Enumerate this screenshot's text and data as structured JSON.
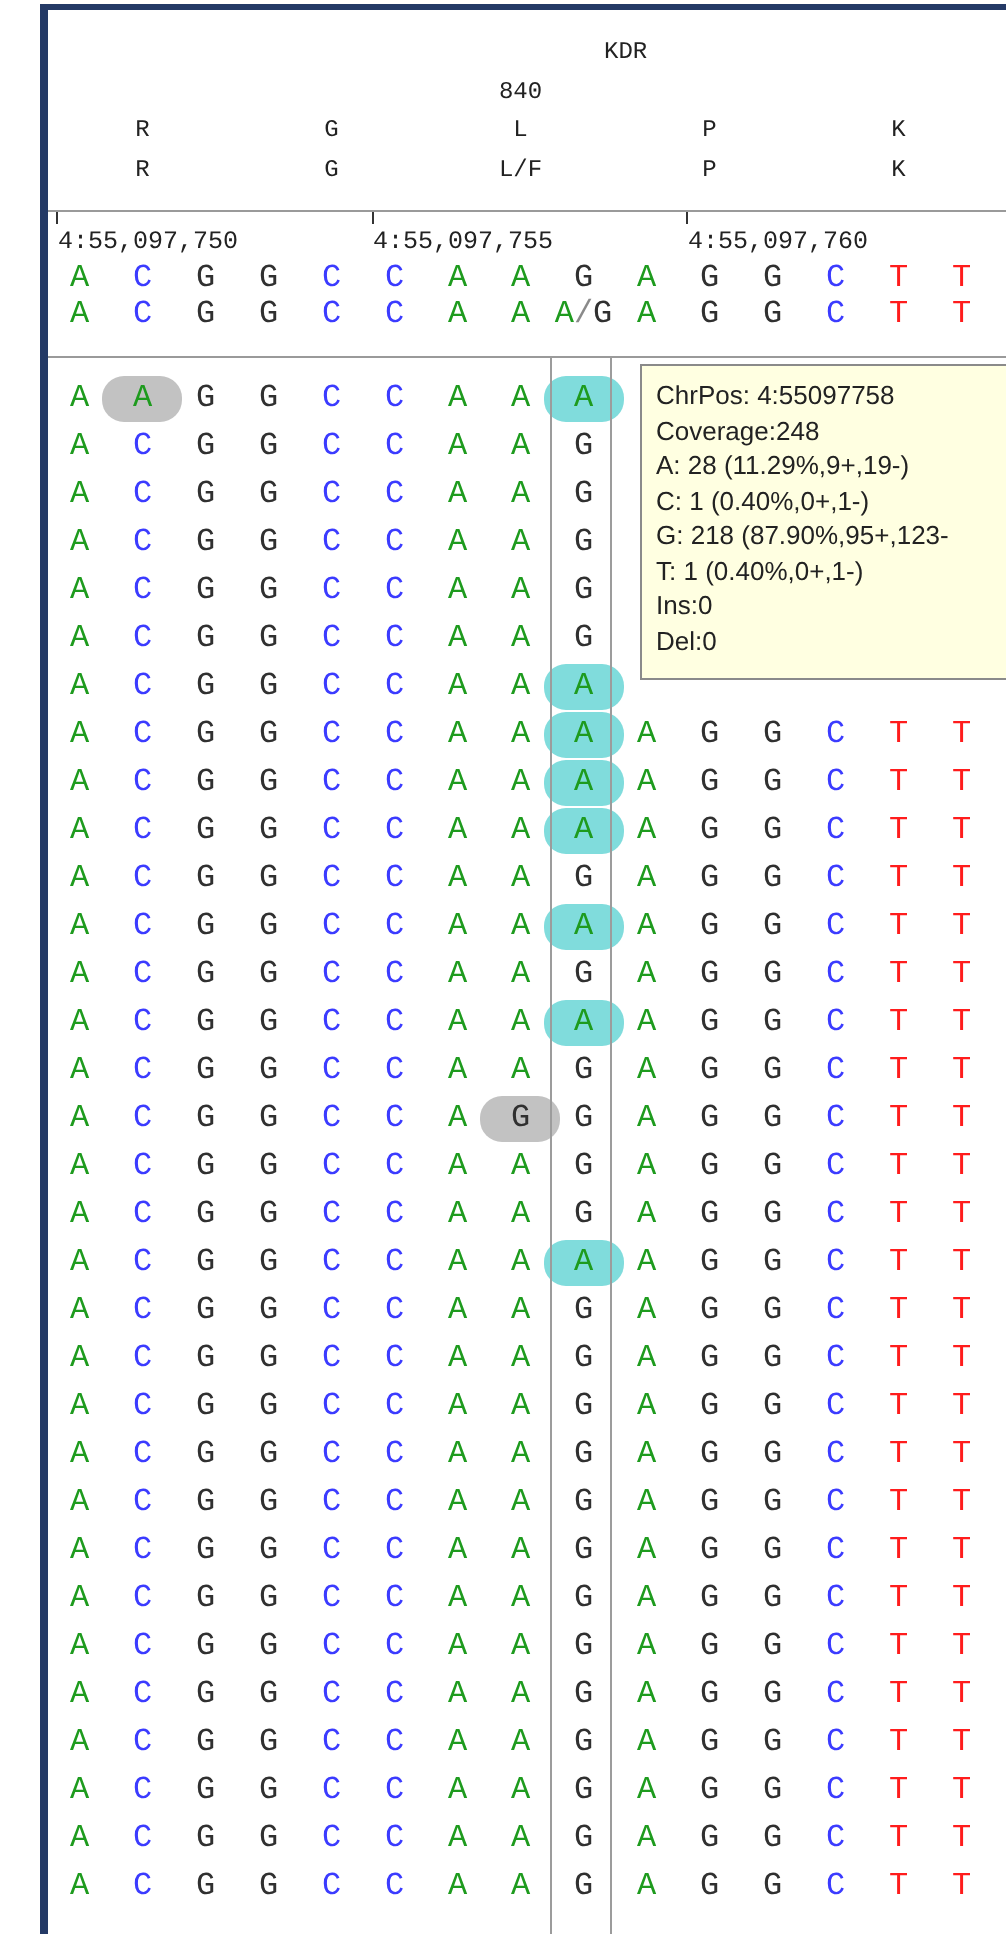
{
  "header": {
    "gene": "KDR",
    "codons": [
      {
        "reference": "R",
        "translated": "R"
      },
      {
        "reference": "G",
        "translated": "G"
      },
      {
        "number": "840",
        "reference": "L",
        "translated": "L/F"
      },
      {
        "reference": "P",
        "translated": "P"
      },
      {
        "reference": "K",
        "translated": "K"
      }
    ]
  },
  "ruler": [
    {
      "label": "4:55,097,750"
    },
    {
      "label": "4:55,097,755"
    },
    {
      "label": "4:55,097,760"
    }
  ],
  "columns": [
    {
      "reference": "A",
      "consensus": "A",
      "selected": false
    },
    {
      "reference": "C",
      "consensus": "C",
      "selected": false
    },
    {
      "reference": "G",
      "consensus": "G",
      "selected": false
    },
    {
      "reference": "G",
      "consensus": "G",
      "selected": false
    },
    {
      "reference": "C",
      "consensus": "C",
      "selected": false
    },
    {
      "reference": "C",
      "consensus": "C",
      "selected": false
    },
    {
      "reference": "A",
      "consensus": "A",
      "selected": false
    },
    {
      "reference": "A",
      "consensus": "A",
      "selected": false
    },
    {
      "reference": "G",
      "consensus": "A/G",
      "selected": true
    },
    {
      "reference": "A",
      "consensus": "A",
      "selected": false
    },
    {
      "reference": "G",
      "consensus": "G",
      "selected": false
    },
    {
      "reference": "G",
      "consensus": "G",
      "selected": false
    },
    {
      "reference": "C",
      "consensus": "C",
      "selected": false
    },
    {
      "reference": "T",
      "consensus": "T",
      "selected": false
    },
    {
      "reference": "T",
      "consensus": "T",
      "selected": false
    }
  ],
  "reads": [
    [
      "A",
      {
        "base": "A",
        "color": "#c2c2c2"
      },
      "G",
      "G",
      "C",
      "C",
      "A",
      "A",
      {
        "base": "A",
        "color": "#80dcdc"
      }
    ],
    [
      "A",
      "C",
      "G",
      "G",
      "C",
      "C",
      "A",
      "A",
      "G"
    ],
    [
      "A",
      "C",
      "G",
      "G",
      "C",
      "C",
      "A",
      "A",
      "G"
    ],
    [
      "A",
      "C",
      "G",
      "G",
      "C",
      "C",
      "A",
      "A",
      "G"
    ],
    [
      "A",
      "C",
      "G",
      "G",
      "C",
      "C",
      "A",
      "A",
      "G"
    ],
    [
      "A",
      "C",
      "G",
      "G",
      "C",
      "C",
      "A",
      "A",
      "G"
    ],
    [
      "A",
      "C",
      "G",
      "G",
      "C",
      "C",
      "A",
      "A",
      {
        "base": "A",
        "color": "#80dcdc"
      }
    ],
    [
      "A",
      "C",
      "G",
      "G",
      "C",
      "C",
      "A",
      "A",
      {
        "base": "A",
        "color": "#80dcdc"
      },
      "A",
      "G",
      "G",
      "C",
      "T",
      "T"
    ],
    [
      "A",
      "C",
      "G",
      "G",
      "C",
      "C",
      "A",
      "A",
      {
        "base": "A",
        "color": "#80dcdc"
      },
      "A",
      "G",
      "G",
      "C",
      "T",
      "T"
    ],
    [
      "A",
      "C",
      "G",
      "G",
      "C",
      "C",
      "A",
      "A",
      {
        "base": "A",
        "color": "#80dcdc"
      },
      "A",
      "G",
      "G",
      "C",
      "T",
      "T"
    ],
    [
      "A",
      "C",
      "G",
      "G",
      "C",
      "C",
      "A",
      "A",
      "G",
      "A",
      "G",
      "G",
      "C",
      "T",
      "T"
    ],
    [
      "A",
      "C",
      "G",
      "G",
      "C",
      "C",
      "A",
      "A",
      {
        "base": "A",
        "color": "#80dcdc"
      },
      "A",
      "G",
      "G",
      "C",
      "T",
      "T"
    ],
    [
      "A",
      "C",
      "G",
      "G",
      "C",
      "C",
      "A",
      "A",
      "G",
      "A",
      "G",
      "G",
      "C",
      "T",
      "T"
    ],
    [
      "A",
      "C",
      "G",
      "G",
      "C",
      "C",
      "A",
      "A",
      {
        "base": "A",
        "color": "#80dcdc"
      },
      "A",
      "G",
      "G",
      "C",
      "T",
      "T"
    ],
    [
      "A",
      "C",
      "G",
      "G",
      "C",
      "C",
      "A",
      "A",
      "G",
      "A",
      "G",
      "G",
      "C",
      "T",
      "T"
    ],
    [
      "A",
      "C",
      "G",
      "G",
      "C",
      "C",
      "A",
      {
        "base": "G",
        "color": "#c2c2c2"
      },
      "G",
      "A",
      "G",
      "G",
      "C",
      "T",
      "T"
    ],
    [
      "A",
      "C",
      "G",
      "G",
      "C",
      "C",
      "A",
      "A",
      "G",
      "A",
      "G",
      "G",
      "C",
      "T",
      "T"
    ],
    [
      "A",
      "C",
      "G",
      "G",
      "C",
      "C",
      "A",
      "A",
      "G",
      "A",
      "G",
      "G",
      "C",
      "T",
      "T"
    ],
    [
      "A",
      "C",
      "G",
      "G",
      "C",
      "C",
      "A",
      "A",
      {
        "base": "A",
        "color": "#80dcdc"
      },
      "A",
      "G",
      "G",
      "C",
      "T",
      "T"
    ],
    [
      "A",
      "C",
      "G",
      "G",
      "C",
      "C",
      "A",
      "A",
      "G",
      "A",
      "G",
      "G",
      "C",
      "T",
      "T"
    ],
    [
      "A",
      "C",
      "G",
      "G",
      "C",
      "C",
      "A",
      "A",
      "G",
      "A",
      "G",
      "G",
      "C",
      "T",
      "T"
    ],
    [
      "A",
      "C",
      "G",
      "G",
      "C",
      "C",
      "A",
      "A",
      "G",
      "A",
      "G",
      "G",
      "C",
      "T",
      "T"
    ],
    [
      "A",
      "C",
      "G",
      "G",
      "C",
      "C",
      "A",
      "A",
      "G",
      "A",
      "G",
      "G",
      "C",
      "T",
      "T"
    ],
    [
      "A",
      "C",
      "G",
      "G",
      "C",
      "C",
      "A",
      "A",
      "G",
      "A",
      "G",
      "G",
      "C",
      "T",
      "T"
    ],
    [
      "A",
      "C",
      "G",
      "G",
      "C",
      "C",
      "A",
      "A",
      "G",
      "A",
      "G",
      "G",
      "C",
      "T",
      "T"
    ],
    [
      "A",
      "C",
      "G",
      "G",
      "C",
      "C",
      "A",
      "A",
      "G",
      "A",
      "G",
      "G",
      "C",
      "T",
      "T"
    ],
    [
      "A",
      "C",
      "G",
      "G",
      "C",
      "C",
      "A",
      "A",
      "G",
      "A",
      "G",
      "G",
      "C",
      "T",
      "T"
    ],
    [
      "A",
      "C",
      "G",
      "G",
      "C",
      "C",
      "A",
      "A",
      "G",
      "A",
      "G",
      "G",
      "C",
      "T",
      "T"
    ],
    [
      "A",
      "C",
      "G",
      "G",
      "C",
      "C",
      "A",
      "A",
      "G",
      "A",
      "G",
      "G",
      "C",
      "T",
      "T"
    ],
    [
      "A",
      "C",
      "G",
      "G",
      "C",
      "C",
      "A",
      "A",
      "G",
      "A",
      "G",
      "G",
      "C",
      "T",
      "T"
    ],
    [
      "A",
      "C",
      "G",
      "G",
      "C",
      "C",
      "A",
      "A",
      "G",
      "A",
      "G",
      "G",
      "C",
      "T",
      "T"
    ],
    [
      "A",
      "C",
      "G",
      "G",
      "C",
      "C",
      "A",
      "A",
      "G",
      "A",
      "G",
      "G",
      "C",
      "T",
      "T"
    ]
  ],
  "tooltip": {
    "lines": [
      "ChrPos: 4:55097758",
      "Coverage:248",
      "A: 28 (11.29%,9+,19-)",
      "C: 1 (0.40%,0+,1-)",
      "G: 218 (87.90%,95+,123-",
      "T: 1 (0.40%,0+,1-)",
      "Ins:0",
      "Del:0"
    ]
  }
}
